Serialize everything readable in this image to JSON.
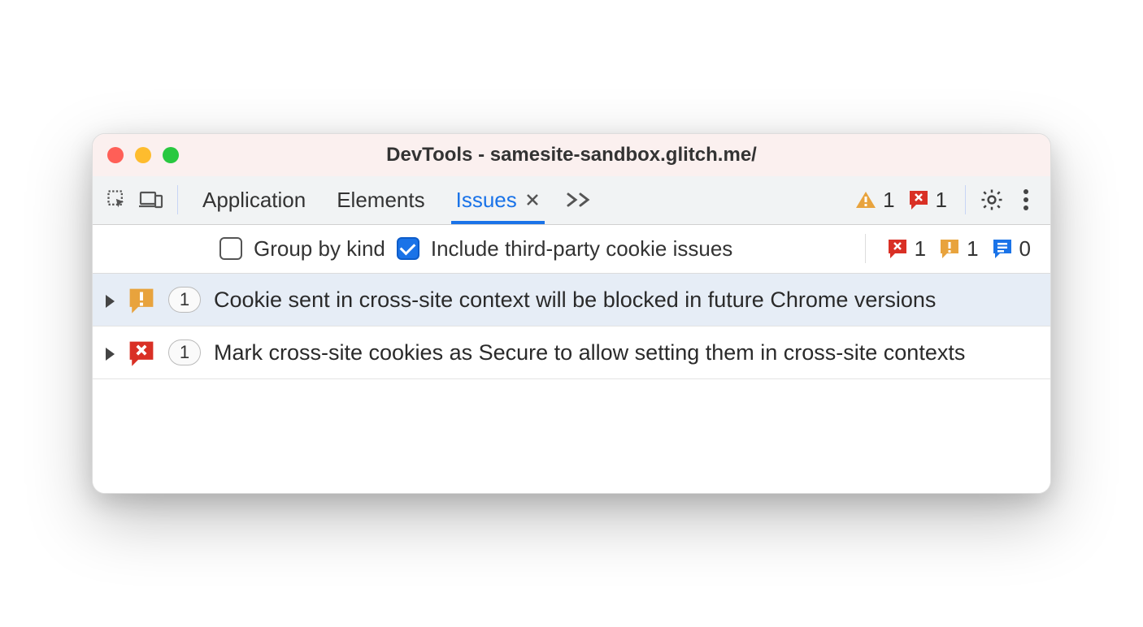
{
  "window": {
    "title": "DevTools - samesite-sandbox.glitch.me/"
  },
  "tabs": [
    {
      "label": "Application",
      "active": false
    },
    {
      "label": "Elements",
      "active": false
    },
    {
      "label": "Issues",
      "active": true
    }
  ],
  "toolbar_counts": {
    "warning": "1",
    "error": "1"
  },
  "filters": {
    "group_by_kind": {
      "label": "Group by kind",
      "checked": false
    },
    "include_third_party": {
      "label": "Include third-party cookie issues",
      "checked": true
    }
  },
  "filterbar_counts": {
    "error": "1",
    "warning": "1",
    "info": "0"
  },
  "issues": [
    {
      "kind": "warning",
      "count": "1",
      "title": "Cookie sent in cross-site context will be blocked in future Chrome versions",
      "selected": true
    },
    {
      "kind": "error",
      "count": "1",
      "title": "Mark cross-site cookies as Secure to allow setting them in cross-site contexts",
      "selected": false
    }
  ],
  "colors": {
    "accent": "#1a73e8",
    "warning": "#e8a33d",
    "error": "#d93025",
    "info": "#1a73e8"
  }
}
